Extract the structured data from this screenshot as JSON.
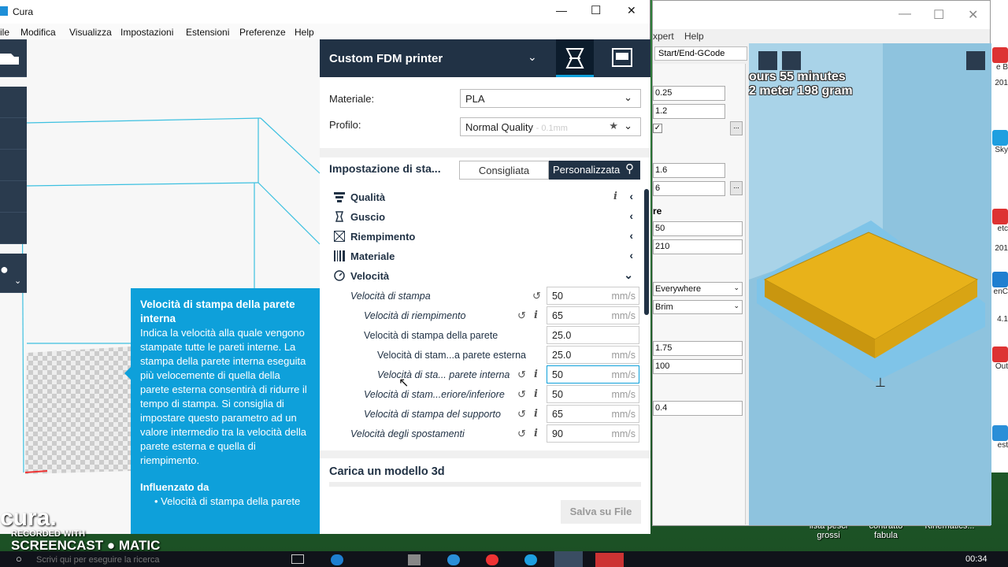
{
  "app": {
    "title": "Cura"
  },
  "menu": [
    "ile",
    "Modifica",
    "Visualizza",
    "Impostazioni",
    "Estensioni",
    "Preferenze",
    "Help"
  ],
  "window_controls": {
    "minimize": "—",
    "maximize": "☐",
    "close": "✕"
  },
  "printer": {
    "name": "Custom FDM printer"
  },
  "material": {
    "label": "Materiale:",
    "value": "PLA"
  },
  "profile": {
    "label": "Profilo:",
    "value": "Normal Quality",
    "hint": "- 0.1mm"
  },
  "settings_header": {
    "title": "Impostazione di sta...",
    "tab_recommended": "Consigliata",
    "tab_custom": "Personalizzata"
  },
  "categories": [
    {
      "label": "Qualità",
      "icon": "quality-icon",
      "arrow": "‹",
      "info": "i"
    },
    {
      "label": "Guscio",
      "icon": "shell-icon",
      "arrow": "‹"
    },
    {
      "label": "Riempimento",
      "icon": "infill-icon",
      "arrow": "‹"
    },
    {
      "label": "Materiale",
      "icon": "material-icon",
      "arrow": "‹"
    },
    {
      "label": "Velocità",
      "icon": "speed-icon",
      "arrow": "⌄"
    }
  ],
  "speed_settings": [
    {
      "label": "Velocità di stampa",
      "value": "50",
      "unit": "mm/s",
      "italic": true
    },
    {
      "label": "Velocità di riempimento",
      "value": "65",
      "unit": "mm/s",
      "italic": true
    },
    {
      "label": "Velocità di stampa della parete",
      "value": "25.0",
      "unit": "",
      "italic": false
    },
    {
      "label": "Velocità di stam...a parete esterna",
      "value": "25.0",
      "unit": "mm/s",
      "italic": false
    },
    {
      "label": "Velocità di sta... parete interna",
      "value": "50",
      "unit": "mm/s",
      "italic": true
    },
    {
      "label": "Velocità di stam...eriore/inferiore",
      "value": "50",
      "unit": "mm/s",
      "italic": true
    },
    {
      "label": "Velocità di stampa del supporto",
      "value": "65",
      "unit": "mm/s",
      "italic": true
    },
    {
      "label": "Velocità degli spostamenti",
      "value": "90",
      "unit": "mm/s",
      "italic": true
    }
  ],
  "load_model": "Carica un modello 3d",
  "save_button": "Salva su File",
  "tooltip": {
    "title": "Velocità di stampa della parete interna",
    "body": "Indica la velocità alla quale vengono stampate tutte le pareti interne. La stampa della parete interna eseguita più velocemente di quella della parete esterna consentirà di ridurre il tempo di stampa. Si consiglia di impostare questo parametro ad un valore intermedio tra la velocità della parete esterna e quella di riempimento.",
    "affected_heading": "Influenzato da",
    "affected_item": "• Velocità di stampa della parete"
  },
  "background_window": {
    "menu": "xpert    Help",
    "tab": "Start/End-GCode",
    "print_time": "ours 55 minutes",
    "print_material": "2 meter 198 gram",
    "fields": [
      "0.25",
      "1.2",
      "1.6",
      "6",
      "50",
      "210",
      "1.75",
      "100",
      "0.4"
    ],
    "selects": [
      "Everywhere",
      "Brim"
    ],
    "section": "re",
    "browse": "..."
  },
  "desktop_icons": [
    "e B",
    "201",
    "Sky",
    "etc",
    "201",
    "enC",
    "4.1",
    "Out",
    "est"
  ],
  "desktop_labels": [
    "lista pesci grossi",
    "contratto fabula",
    "Kinematics..."
  ],
  "watermark": {
    "line1": "RECORDED WITH",
    "line2": "SCREENCAST",
    "line3": "MATIC",
    "logo": "cura."
  },
  "taskbar": {
    "search": "Scrivi qui per eseguire la ricerca",
    "time": "00:34"
  },
  "colors": {
    "accent": "#0ea0da",
    "header": "#213245",
    "model": "#e8b21a"
  }
}
